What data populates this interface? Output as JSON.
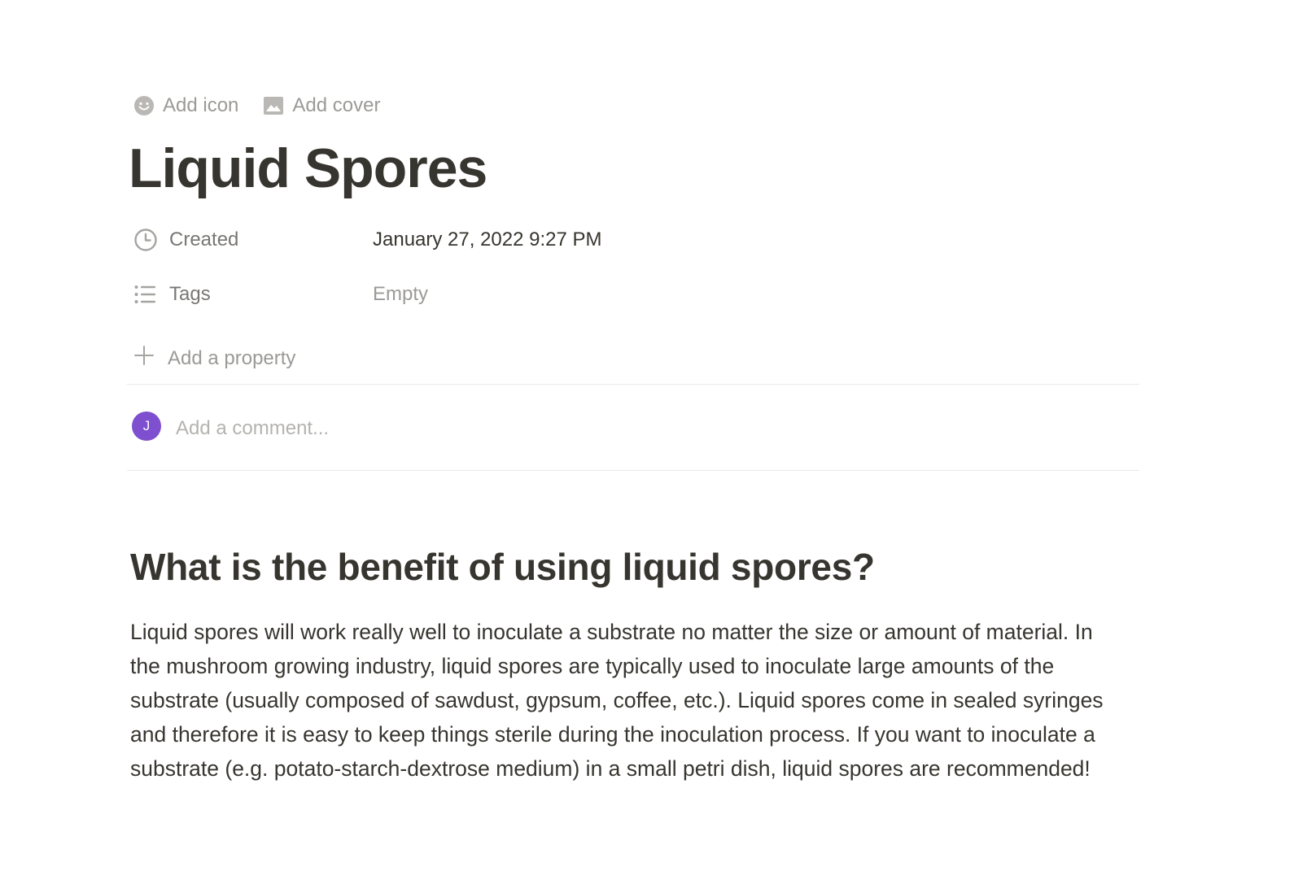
{
  "page_controls": {
    "add_icon_label": "Add icon",
    "add_cover_label": "Add cover"
  },
  "title": "Liquid Spores",
  "properties": {
    "created": {
      "name": "Created",
      "value": "January 27, 2022 9:27 PM"
    },
    "tags": {
      "name": "Tags",
      "value": "Empty"
    },
    "add_property_label": "Add a property"
  },
  "comment": {
    "avatar_initial": "J",
    "placeholder": "Add a comment...",
    "avatar_color": "#7e4fcf"
  },
  "content": {
    "heading": "What is the benefit of using liquid spores?",
    "paragraph": "Liquid spores will work really well to inoculate a substrate no matter the size or amount of material. In the mushroom growing industry, liquid spores are typically used to inoculate large amounts of the substrate (usually composed of sawdust, gypsum, coffee, etc.). Liquid spores come in sealed syringes and therefore it is easy to keep things sterile during the inoculation process. If you want to inoculate a substrate (e.g. potato-starch-dextrose medium) in a small petri dish, liquid spores are recommended!"
  },
  "icons": {
    "add_icon": "smiley-face-icon",
    "add_cover": "image-icon",
    "created": "clock-icon",
    "tags": "list-icon",
    "add_property": "plus-icon"
  }
}
